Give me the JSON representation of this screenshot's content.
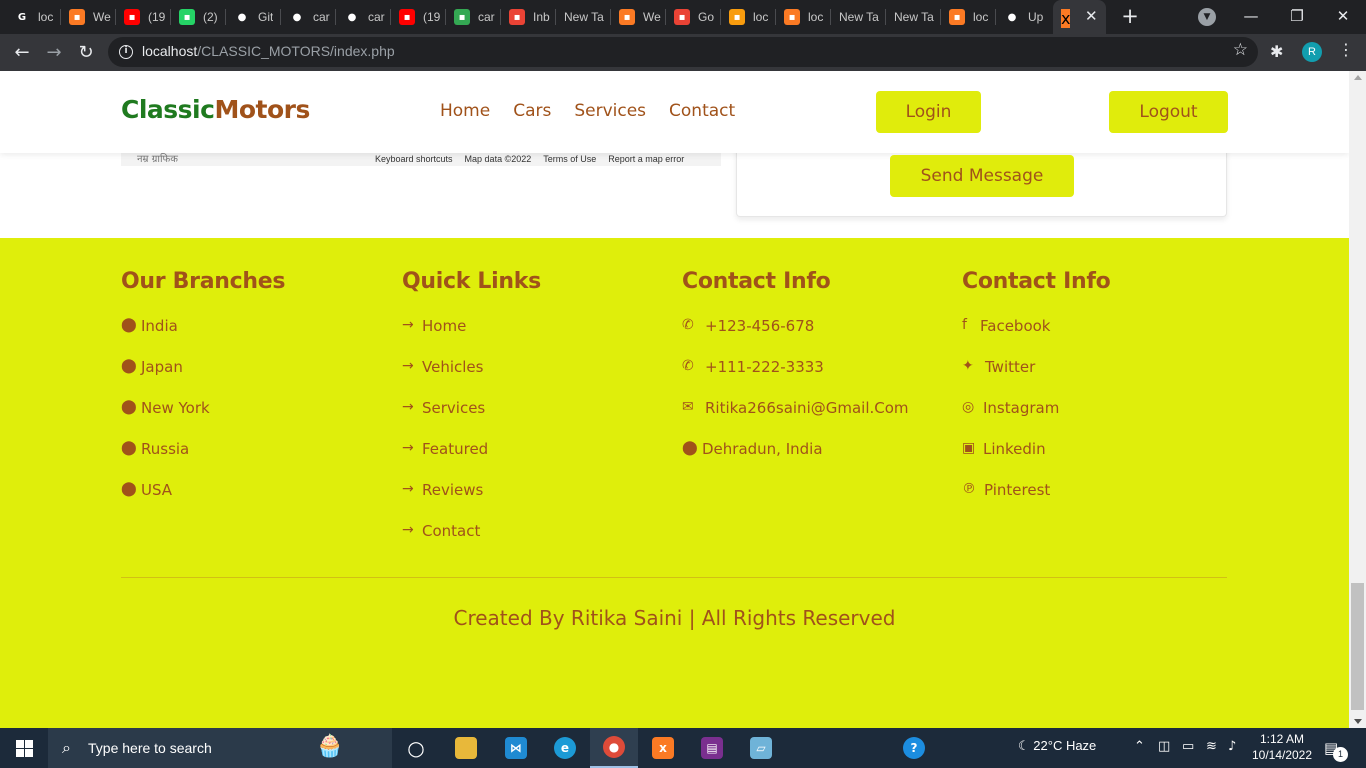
{
  "browser": {
    "tabs": [
      {
        "label": "loc",
        "icon": "google-icon",
        "color": "#ffffff"
      },
      {
        "label": "We",
        "icon": "xampp-icon",
        "color": "#fb7a24"
      },
      {
        "label": "(19",
        "icon": "youtube-icon",
        "color": "#ff0000"
      },
      {
        "label": "(2)",
        "icon": "whatsapp-icon",
        "color": "#25d366"
      },
      {
        "label": "Git",
        "icon": "github-icon",
        "color": "#ffffff"
      },
      {
        "label": "car",
        "icon": "github-icon",
        "color": "#ffffff"
      },
      {
        "label": "car",
        "icon": "github-icon",
        "color": "#ffffff"
      },
      {
        "label": "(19",
        "icon": "youtube-icon",
        "color": "#ff0000"
      },
      {
        "label": "car",
        "icon": "google-drive-icon",
        "color": "#34a853"
      },
      {
        "label": "Inb",
        "icon": "gmail-icon",
        "color": "#ea4335"
      },
      {
        "label": "New Ta",
        "icon": "",
        "color": ""
      },
      {
        "label": "We",
        "icon": "xampp-icon",
        "color": "#fb7a24"
      },
      {
        "label": "Go",
        "icon": "google-maps-icon",
        "color": "#ea4335"
      },
      {
        "label": "loc",
        "icon": "php-myadmin-icon",
        "color": "#f89c0e"
      },
      {
        "label": "loc",
        "icon": "xampp-icon",
        "color": "#fb7a24"
      },
      {
        "label": "New Ta",
        "icon": "",
        "color": ""
      },
      {
        "label": "New Ta",
        "icon": "",
        "color": ""
      },
      {
        "label": "loc",
        "icon": "xampp-icon",
        "color": "#fb7a24"
      },
      {
        "label": "Up",
        "icon": "github-icon",
        "color": "#ffffff"
      }
    ],
    "active_tab_icon": "xampp-icon",
    "url_host": "localhost",
    "url_path": "/CLASSIC_MOTORS/index.php",
    "profile_initial": "R"
  },
  "site": {
    "logo_part1": "Classic",
    "logo_part2": "Motors",
    "nav": [
      "Home",
      "Cars",
      "Services",
      "Contact"
    ],
    "login_label": "Login",
    "logout_label": "Logout",
    "map_hindi_label": "नम्र ग्राफिक",
    "map_footer_links": [
      "Keyboard shortcuts",
      "Map data ©2022",
      "Terms of Use",
      "Report a map error"
    ],
    "send_label": "Send Message",
    "colors": {
      "accent": "#dfee0b",
      "brand_brown": "#a0521a",
      "brand_green": "#1f7a1f"
    }
  },
  "footer": {
    "branches": {
      "title": "Our Branches",
      "items": [
        "India",
        "Japan",
        "New York",
        "Russia",
        "USA"
      ]
    },
    "quick_links": {
      "title": "Quick Links",
      "items": [
        "Home",
        "Vehicles",
        "Services",
        "Featured",
        "Reviews",
        "Contact"
      ]
    },
    "contact": {
      "title": "Contact Info",
      "items": [
        {
          "icon": "phone-icon",
          "text": "+123-456-678"
        },
        {
          "icon": "phone-icon",
          "text": "+111-222-3333"
        },
        {
          "icon": "envelope-icon",
          "text": "Ritika266saini@Gmail.Com"
        },
        {
          "icon": "map-marker-icon",
          "text": "Dehradun, India"
        }
      ]
    },
    "social": {
      "title": "Contact Info",
      "items": [
        {
          "icon": "facebook-icon",
          "text": "Facebook"
        },
        {
          "icon": "twitter-icon",
          "text": "Twitter"
        },
        {
          "icon": "instagram-icon",
          "text": "Instagram"
        },
        {
          "icon": "linkedin-icon",
          "text": "Linkedin"
        },
        {
          "icon": "pinterest-icon",
          "text": "Pinterest"
        }
      ]
    },
    "credit": "Created By Ritika Saini | All Rights Reserved"
  },
  "taskbar": {
    "search_placeholder": "Type here to search",
    "weather": "22°C  Haze",
    "time": "1:12 AM",
    "date": "10/14/2022",
    "notification_count": "1"
  }
}
